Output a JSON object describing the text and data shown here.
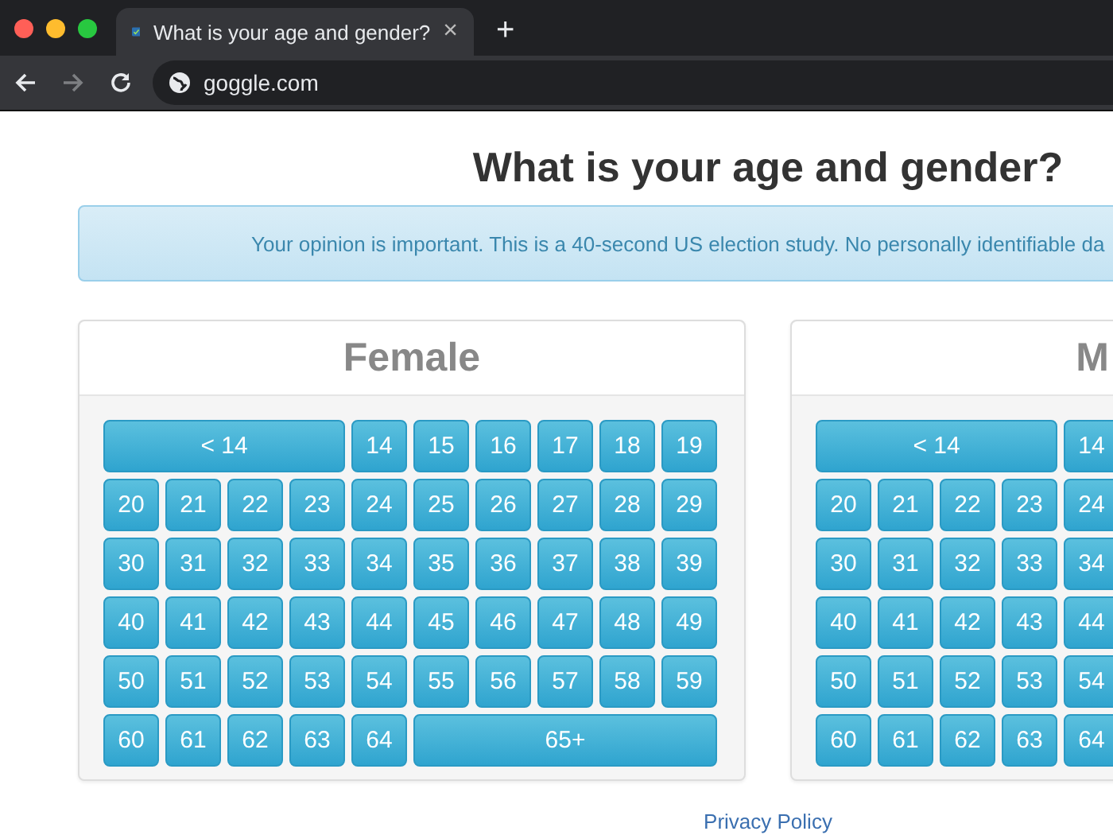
{
  "browser": {
    "tab_title": "What is your age and gender?",
    "close": "×",
    "new_tab": "+",
    "url": "goggle.com",
    "forward_disabled": true
  },
  "page": {
    "title": "What is your age and gender?",
    "notice": "Your opinion is important. This is a 40-second US election study. No personally identifiable da",
    "panels": [
      {
        "title": "Female",
        "buttons": [
          {
            "label": "< 14",
            "kind": "wide"
          },
          {
            "label": "14",
            "kind": "age"
          },
          {
            "label": "15",
            "kind": "age"
          },
          {
            "label": "16",
            "kind": "age"
          },
          {
            "label": "17",
            "kind": "age"
          },
          {
            "label": "18",
            "kind": "age"
          },
          {
            "label": "19",
            "kind": "age"
          },
          {
            "label": "20",
            "kind": "age"
          },
          {
            "label": "21",
            "kind": "age"
          },
          {
            "label": "22",
            "kind": "age"
          },
          {
            "label": "23",
            "kind": "age"
          },
          {
            "label": "24",
            "kind": "age"
          },
          {
            "label": "25",
            "kind": "age"
          },
          {
            "label": "26",
            "kind": "age"
          },
          {
            "label": "27",
            "kind": "age"
          },
          {
            "label": "28",
            "kind": "age"
          },
          {
            "label": "29",
            "kind": "age"
          },
          {
            "label": "30",
            "kind": "age"
          },
          {
            "label": "31",
            "kind": "age"
          },
          {
            "label": "32",
            "kind": "age"
          },
          {
            "label": "33",
            "kind": "age"
          },
          {
            "label": "34",
            "kind": "age"
          },
          {
            "label": "35",
            "kind": "age"
          },
          {
            "label": "36",
            "kind": "age"
          },
          {
            "label": "37",
            "kind": "age"
          },
          {
            "label": "38",
            "kind": "age"
          },
          {
            "label": "39",
            "kind": "age"
          },
          {
            "label": "40",
            "kind": "age"
          },
          {
            "label": "41",
            "kind": "age"
          },
          {
            "label": "42",
            "kind": "age"
          },
          {
            "label": "43",
            "kind": "age"
          },
          {
            "label": "44",
            "kind": "age"
          },
          {
            "label": "45",
            "kind": "age"
          },
          {
            "label": "46",
            "kind": "age"
          },
          {
            "label": "47",
            "kind": "age"
          },
          {
            "label": "48",
            "kind": "age"
          },
          {
            "label": "49",
            "kind": "age"
          },
          {
            "label": "50",
            "kind": "age"
          },
          {
            "label": "51",
            "kind": "age"
          },
          {
            "label": "52",
            "kind": "age"
          },
          {
            "label": "53",
            "kind": "age"
          },
          {
            "label": "54",
            "kind": "age"
          },
          {
            "label": "55",
            "kind": "age"
          },
          {
            "label": "56",
            "kind": "age"
          },
          {
            "label": "57",
            "kind": "age"
          },
          {
            "label": "58",
            "kind": "age"
          },
          {
            "label": "59",
            "kind": "age"
          },
          {
            "label": "60",
            "kind": "age"
          },
          {
            "label": "61",
            "kind": "age"
          },
          {
            "label": "62",
            "kind": "age"
          },
          {
            "label": "63",
            "kind": "age"
          },
          {
            "label": "64",
            "kind": "age"
          },
          {
            "label": "65+",
            "kind": "rest"
          }
        ]
      },
      {
        "title": "M",
        "buttons": [
          {
            "label": "< 14",
            "kind": "wide"
          },
          {
            "label": "14",
            "kind": "age"
          },
          {
            "label": "20",
            "kind": "age"
          },
          {
            "label": "21",
            "kind": "age"
          },
          {
            "label": "22",
            "kind": "age"
          },
          {
            "label": "23",
            "kind": "age"
          },
          {
            "label": "24",
            "kind": "age"
          },
          {
            "label": "30",
            "kind": "age"
          },
          {
            "label": "31",
            "kind": "age"
          },
          {
            "label": "32",
            "kind": "age"
          },
          {
            "label": "33",
            "kind": "age"
          },
          {
            "label": "34",
            "kind": "age"
          },
          {
            "label": "40",
            "kind": "age"
          },
          {
            "label": "41",
            "kind": "age"
          },
          {
            "label": "42",
            "kind": "age"
          },
          {
            "label": "43",
            "kind": "age"
          },
          {
            "label": "44",
            "kind": "age"
          },
          {
            "label": "50",
            "kind": "age"
          },
          {
            "label": "51",
            "kind": "age"
          },
          {
            "label": "52",
            "kind": "age"
          },
          {
            "label": "53",
            "kind": "age"
          },
          {
            "label": "54",
            "kind": "age"
          },
          {
            "label": "60",
            "kind": "age"
          },
          {
            "label": "61",
            "kind": "age"
          },
          {
            "label": "62",
            "kind": "age"
          },
          {
            "label": "63",
            "kind": "age"
          },
          {
            "label": "64",
            "kind": "age"
          }
        ]
      }
    ],
    "footer_link": "Privacy Policy"
  }
}
